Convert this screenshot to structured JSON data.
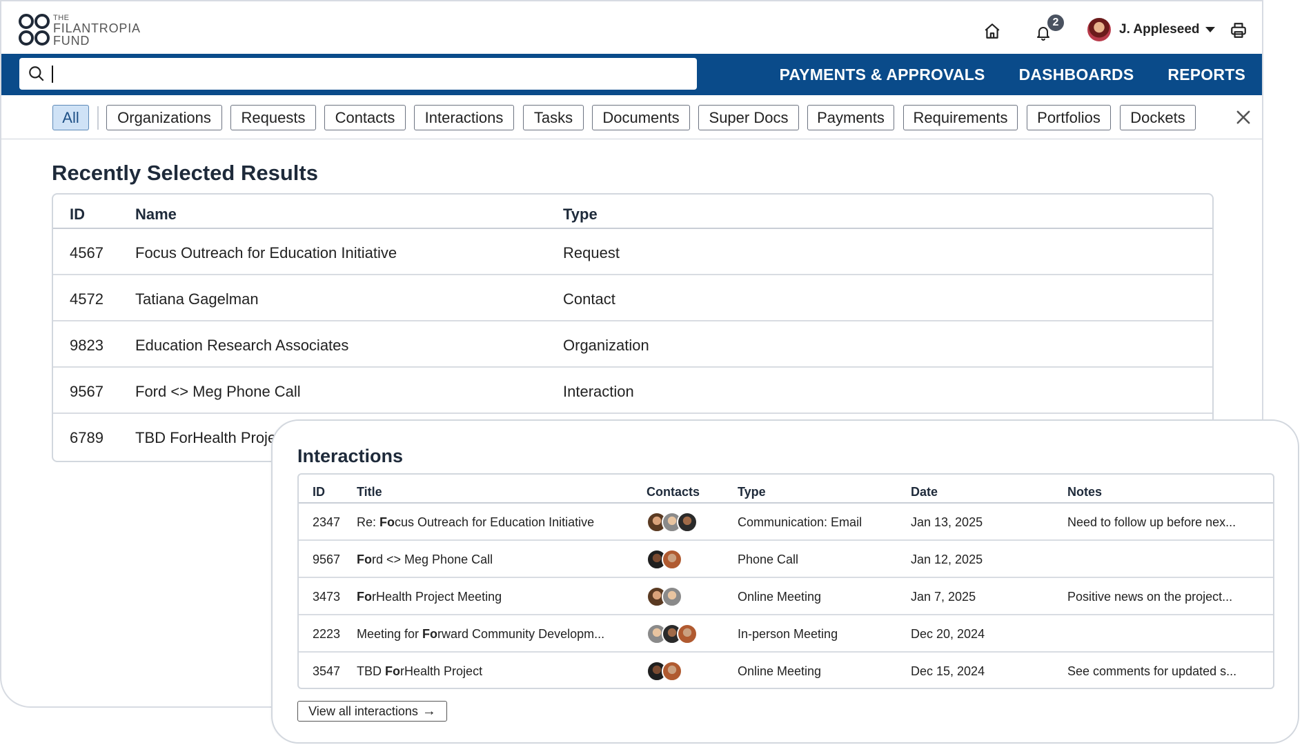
{
  "brand": {
    "the": "THE",
    "line1": "FILANTROPIA",
    "line2": "FUND"
  },
  "header": {
    "notifications_count": "2",
    "user_name": "J. Appleseed"
  },
  "nav": {
    "search_value": "",
    "links": [
      "PAYMENTS & APPROVALS",
      "DASHBOARDS",
      "REPORTS"
    ]
  },
  "filters": {
    "active": "All",
    "chips": [
      "All",
      "Organizations",
      "Requests",
      "Contacts",
      "Interactions",
      "Tasks",
      "Documents",
      "Super Docs",
      "Payments",
      "Requirements",
      "Portfolios",
      "Dockets"
    ]
  },
  "recent": {
    "title": "Recently Selected Results",
    "columns": [
      "ID",
      "Name",
      "Type"
    ],
    "rows": [
      {
        "id": "4567",
        "name": "Focus Outreach for Education Initiative",
        "type": "Request"
      },
      {
        "id": "4572",
        "name": "Tatiana Gagelman",
        "type": "Contact"
      },
      {
        "id": "9823",
        "name": "Education Research Associates",
        "type": "Organization"
      },
      {
        "id": "9567",
        "name": "Ford <> Meg Phone Call",
        "type": "Interaction"
      },
      {
        "id": "6789",
        "name": "TBD ForHealth Proje",
        "type": ""
      }
    ]
  },
  "interactions": {
    "title": "Interactions",
    "columns": [
      "ID",
      "Title",
      "Contacts",
      "Type",
      "Date",
      "Notes"
    ],
    "rows": [
      {
        "id": "2347",
        "title_pre": "Re: ",
        "title_bold": "Fo",
        "title_post": "cus Outreach for Education Initiative",
        "type": "Communication: Email",
        "date": "Jan 13, 2025",
        "notes": "Need to follow up before nex..."
      },
      {
        "id": "9567",
        "title_pre": "",
        "title_bold": "Fo",
        "title_post": "rd <> Meg Phone Call",
        "type": "Phone Call",
        "date": "Jan 12, 2025",
        "notes": ""
      },
      {
        "id": "3473",
        "title_pre": "",
        "title_bold": "Fo",
        "title_post": "rHealth Project Meeting",
        "type": "Online Meeting",
        "date": "Jan 7, 2025",
        "notes": "Positive news on the project..."
      },
      {
        "id": "2223",
        "title_pre": "Meeting for ",
        "title_bold": "Fo",
        "title_post": "rward Community Developm...",
        "type": "In-person Meeting",
        "date": "Dec 20, 2024",
        "notes": ""
      },
      {
        "id": "3547",
        "title_pre": "TBD ",
        "title_bold": "Fo",
        "title_post": "rHealth Project",
        "type": "Online Meeting",
        "date": "Dec 15, 2024",
        "notes": "See comments for updated s..."
      }
    ],
    "view_all": "View all interactions"
  }
}
